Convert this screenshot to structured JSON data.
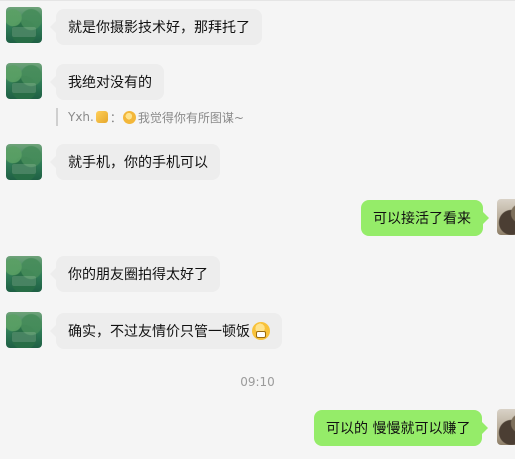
{
  "messages": [
    {
      "side": "left",
      "text": "就是你摄影技术好，那拜托了"
    },
    {
      "side": "left",
      "text": "我绝对没有的"
    },
    {
      "side": "left",
      "text": "就手机，你的手机可以"
    },
    {
      "side": "right",
      "text": "可以接活了看来"
    },
    {
      "side": "left",
      "text": "你的朋友圈拍得太好了"
    },
    {
      "side": "left",
      "text": "确实，不过友情价只管一顿饭",
      "emoji": "grin"
    },
    {
      "side": "right",
      "text": "可以的 慢慢就可以赚了"
    }
  ],
  "quote": {
    "author": "Yxh.",
    "separator": "：",
    "text": "我觉得你有所图谋~"
  },
  "timestamp": "09:10",
  "colors": {
    "background": "#f5f5f5",
    "bubble_received": "#ededed",
    "bubble_sent": "#95ec69"
  }
}
